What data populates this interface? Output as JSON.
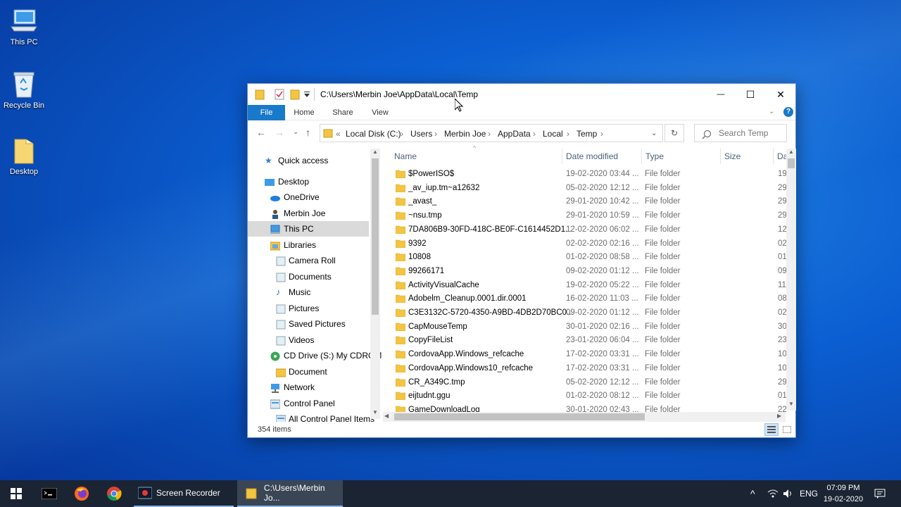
{
  "desktop": {
    "icons": [
      {
        "label": "This PC"
      },
      {
        "label": "Recycle Bin"
      },
      {
        "label": "Desktop"
      }
    ]
  },
  "window": {
    "title": "C:\\Users\\Merbin Joe\\AppData\\Local\\Temp",
    "controls": {
      "minimize": "—",
      "maximize": "☐",
      "close": "✕"
    },
    "ribbon_tabs": [
      "File",
      "Home",
      "Share",
      "View"
    ],
    "address": {
      "prefix": "«",
      "crumbs": [
        "Local Disk (C:)",
        "Users",
        "Merbin Joe",
        "AppData",
        "Local",
        "Temp"
      ]
    },
    "search_placeholder": "Search Temp",
    "nav_pane": [
      {
        "label": "Quick access",
        "icon": "star-icon"
      },
      {
        "label": "Desktop",
        "icon": "desktop-icon"
      },
      {
        "label": "OneDrive",
        "icon": "cloud-icon"
      },
      {
        "label": "Merbin Joe",
        "icon": "user-icon"
      },
      {
        "label": "This PC",
        "icon": "pc-icon",
        "selected": true
      },
      {
        "label": "Libraries",
        "icon": "library-icon"
      },
      {
        "label": "Camera Roll",
        "icon": "library-folder-icon"
      },
      {
        "label": "Documents",
        "icon": "library-folder-icon"
      },
      {
        "label": "Music",
        "icon": "music-icon"
      },
      {
        "label": "Pictures",
        "icon": "library-folder-icon"
      },
      {
        "label": "Saved Pictures",
        "icon": "library-folder-icon"
      },
      {
        "label": "Videos",
        "icon": "library-folder-icon"
      },
      {
        "label": "CD Drive (S:) My CDROM",
        "icon": "cd-drive-icon"
      },
      {
        "label": "Document",
        "icon": "folder-icon"
      },
      {
        "label": "Network",
        "icon": "network-icon"
      },
      {
        "label": "Control Panel",
        "icon": "control-panel-icon"
      },
      {
        "label": "All Control Panel Items",
        "icon": "control-panel-icon"
      }
    ],
    "columns": {
      "name": "Name",
      "date": "Date modified",
      "type": "Type",
      "size": "Size",
      "extra": "Da"
    },
    "files": [
      {
        "name": "$PowerISO$",
        "date": "19-02-2020 03:44 ...",
        "type": "File folder",
        "trail": "19"
      },
      {
        "name": "_av_iup.tm~a12632",
        "date": "05-02-2020 12:12 ...",
        "type": "File folder",
        "trail": "29"
      },
      {
        "name": "_avast_",
        "date": "29-01-2020 10:42 ...",
        "type": "File folder",
        "trail": "29"
      },
      {
        "name": "~nsu.tmp",
        "date": "29-01-2020 10:59 ...",
        "type": "File folder",
        "trail": "29"
      },
      {
        "name": "7DA806B9-30FD-418C-BE0F-C1614452D1...",
        "date": "12-02-2020 06:02 ...",
        "type": "File folder",
        "trail": "12"
      },
      {
        "name": "9392",
        "date": "02-02-2020 02:16 ...",
        "type": "File folder",
        "trail": "02"
      },
      {
        "name": "10808",
        "date": "01-02-2020 08:58 ...",
        "type": "File folder",
        "trail": "01"
      },
      {
        "name": "99266171",
        "date": "09-02-2020 01:12 ...",
        "type": "File folder",
        "trail": "09"
      },
      {
        "name": "ActivityVisualCache",
        "date": "19-02-2020 05:22 ...",
        "type": "File folder",
        "trail": "11"
      },
      {
        "name": "Adobelm_Cleanup.0001.dir.0001",
        "date": "16-02-2020 11:03 ...",
        "type": "File folder",
        "trail": "08"
      },
      {
        "name": "C3E3132C-5720-4350-A9BD-4DB2D70BC0...",
        "date": "09-02-2020 01:12 ...",
        "type": "File folder",
        "trail": "02"
      },
      {
        "name": "CapMouseTemp",
        "date": "30-01-2020 02:16 ...",
        "type": "File folder",
        "trail": "30"
      },
      {
        "name": "CopyFileList",
        "date": "23-01-2020 06:04 ...",
        "type": "File folder",
        "trail": "23"
      },
      {
        "name": "CordovaApp.Windows_refcache",
        "date": "17-02-2020 03:31 ...",
        "type": "File folder",
        "trail": "10"
      },
      {
        "name": "CordovaApp.Windows10_refcache",
        "date": "17-02-2020 03:31 ...",
        "type": "File folder",
        "trail": "10"
      },
      {
        "name": "CR_A349C.tmp",
        "date": "05-02-2020 12:12 ...",
        "type": "File folder",
        "trail": "29"
      },
      {
        "name": "eijtudnt.ggu",
        "date": "01-02-2020 08:12 ...",
        "type": "File folder",
        "trail": "01"
      },
      {
        "name": "GameDownloadLog",
        "date": "30-01-2020 02:43 ...",
        "type": "File folder",
        "trail": "22"
      }
    ],
    "status": "354 items"
  },
  "taskbar": {
    "apps": [
      {
        "label": "",
        "icon": "windows-start-icon"
      },
      {
        "label": "",
        "icon": "terminal-icon"
      },
      {
        "label": "",
        "icon": "firefox-icon"
      },
      {
        "label": "",
        "icon": "chrome-icon"
      },
      {
        "label": "Screen Recorder",
        "icon": "screen-recorder-icon"
      },
      {
        "label": "C:\\Users\\Merbin Jo...",
        "icon": "folder-icon"
      }
    ],
    "lang": "ENG",
    "time": "07:09 PM",
    "date": "19-02-2020"
  },
  "colors": {
    "accent": "#1979ca",
    "folder": "#f4c542",
    "taskbar": "#1a2433"
  }
}
